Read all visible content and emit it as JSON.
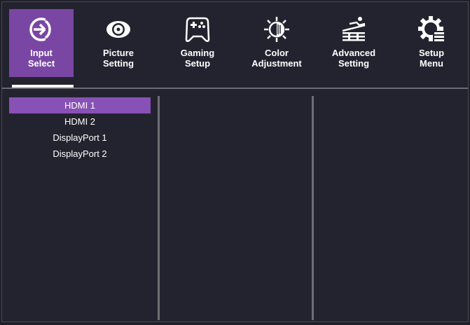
{
  "menu": {
    "items": [
      {
        "label": "Input\nSelect",
        "icon": "input-arrow-icon",
        "active": true
      },
      {
        "label": "Picture\nSetting",
        "icon": "eye-icon",
        "active": false
      },
      {
        "label": "Gaming\nSetup",
        "icon": "gamepad-icon",
        "active": false
      },
      {
        "label": "Color\nAdjustment",
        "icon": "color-adjust-icon",
        "active": false
      },
      {
        "label": "Advanced\nSetting",
        "icon": "advanced-setting-icon",
        "active": false
      },
      {
        "label": "Setup\nMenu",
        "icon": "gear-menu-icon",
        "active": false
      }
    ]
  },
  "input_select": {
    "options": [
      "HDMI 1",
      "HDMI 2",
      "DisplayPort 1",
      "DisplayPort 2"
    ],
    "selected": "HDMI 1"
  },
  "colors": {
    "active_tab": "#7a46a3",
    "selected_option": "#8751b5",
    "background": "#23232f"
  }
}
